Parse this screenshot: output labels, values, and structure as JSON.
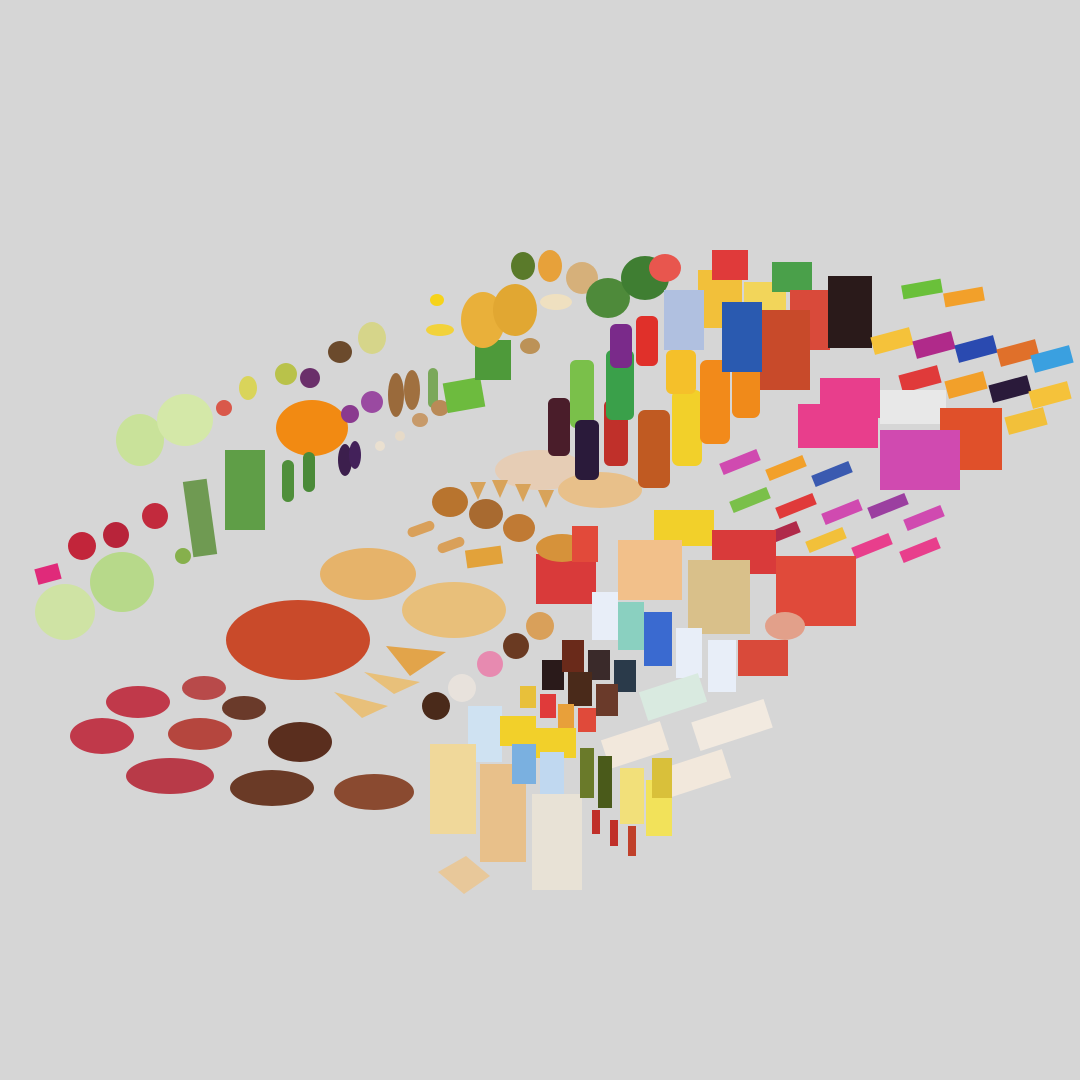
{
  "scene": {
    "background": "#d6d6d6",
    "description_visible_text": "",
    "groups": [
      {
        "id": "vegetables",
        "icon": "vegetable-icon"
      },
      {
        "id": "fruits",
        "icon": "fruit-icon"
      },
      {
        "id": "fast-food",
        "icon": "burger-icon"
      },
      {
        "id": "pizza",
        "icon": "pizza-icon"
      },
      {
        "id": "meat",
        "icon": "steak-icon"
      },
      {
        "id": "drinks",
        "icon": "bottle-icon"
      },
      {
        "id": "cereal-boxes",
        "icon": "box-icon"
      },
      {
        "id": "snacks",
        "icon": "snack-bag-icon"
      },
      {
        "id": "candy-bars",
        "icon": "candy-icon"
      },
      {
        "id": "dairy",
        "icon": "milk-carton-icon"
      },
      {
        "id": "canned-goods",
        "icon": "can-icon"
      },
      {
        "id": "bread",
        "icon": "bread-icon"
      },
      {
        "id": "condiments",
        "icon": "sauce-bottle-icon"
      }
    ],
    "palette": {
      "green": "#8fbf5a",
      "red": "#c0392b",
      "orange": "#f08a1c",
      "yellow": "#f2c94c",
      "purple": "#9b3fa0",
      "pink": "#e83e8c",
      "brown": "#7a4a2a",
      "cream": "#f1e4c4",
      "blue": "#3a7bd5"
    }
  }
}
